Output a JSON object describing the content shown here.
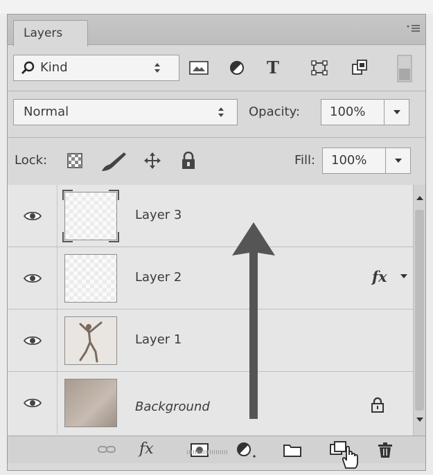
{
  "panel": {
    "tab_label": "Layers"
  },
  "filter": {
    "kind_label": "Kind",
    "icons": [
      "image-filter-icon",
      "adjustment-filter-icon",
      "type-filter-icon",
      "shape-filter-icon",
      "smart-object-filter-icon",
      "filter-toggle-icon"
    ],
    "type_glyph": "T"
  },
  "blend": {
    "mode": "Normal",
    "opacity_label": "Opacity:",
    "opacity_value": "100%"
  },
  "lock": {
    "label": "Lock:",
    "fill_label": "Fill:",
    "fill_value": "100%"
  },
  "layers": [
    {
      "name": "Layer 3",
      "italic": false,
      "fx": false,
      "locked": false
    },
    {
      "name": "Layer 2",
      "italic": false,
      "fx": true,
      "fx_label": "fx",
      "locked": false
    },
    {
      "name": "Layer 1",
      "italic": false,
      "fx": false,
      "locked": false
    },
    {
      "name": "Background",
      "italic": true,
      "fx": false,
      "locked": true
    }
  ],
  "bottom_bar": {
    "icons": [
      "link-layers-icon",
      "add-layer-style-icon",
      "add-mask-icon",
      "new-adjustment-layer-icon",
      "new-group-icon",
      "new-layer-icon",
      "delete-layer-icon"
    ],
    "fx_label": "fx"
  },
  "colors": {
    "panel_bg": "#d9d9d9",
    "list_bg": "#e6e6e6",
    "arrow": "#555555"
  }
}
